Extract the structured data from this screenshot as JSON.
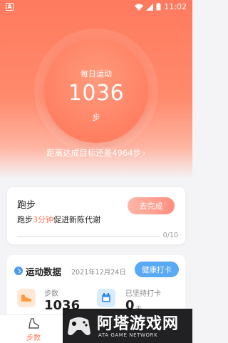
{
  "status_bar": {
    "app_badge": "A",
    "time": "11:02"
  },
  "hero": {
    "daily_label": "每日运动",
    "steps": "1036",
    "steps_unit": "步",
    "goal_text": "距离达成目标还差4964步",
    "goal_chevron": "›"
  },
  "task": {
    "title": "跑步",
    "desc_prefix": "跑步",
    "desc_highlight": "3分钟",
    "desc_suffix": "促进新陈代谢",
    "button": "去完成",
    "progress_text": "0/10",
    "progress_fraction": 0
  },
  "sport_data": {
    "title": "运动数据",
    "date": "2021年12月24日",
    "checkin_button": "健康打卡",
    "stats": [
      {
        "label": "步数",
        "value": "1036",
        "icon": "shoe-icon"
      },
      {
        "label": "已坚持打卡",
        "value": "0",
        "unit": "天",
        "icon": "calendar-icon"
      }
    ]
  },
  "nav": {
    "steps_label": "步数"
  },
  "watermark": {
    "title": "阿塔游戏网",
    "subtitle": "ATA GAME NETWORK"
  },
  "colors": {
    "accent": "#ff7a5e",
    "blue": "#5aa9f5"
  }
}
